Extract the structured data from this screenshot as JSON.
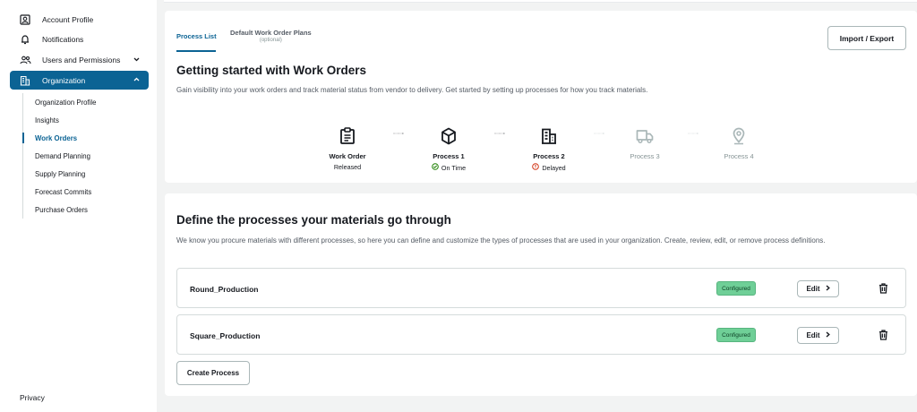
{
  "sidebar": {
    "items": [
      {
        "label": "Account Profile",
        "icon": "account-icon"
      },
      {
        "label": "Notifications",
        "icon": "bell-icon"
      },
      {
        "label": "Users and Permissions",
        "icon": "users-icon"
      },
      {
        "label": "Organization",
        "icon": "building-icon"
      }
    ],
    "sub_items": [
      {
        "label": "Organization Profile"
      },
      {
        "label": "Insights"
      },
      {
        "label": "Work Orders"
      },
      {
        "label": "Demand Planning"
      },
      {
        "label": "Supply Planning"
      },
      {
        "label": "Forecast Commits"
      },
      {
        "label": "Purchase Orders"
      }
    ],
    "privacy": "Privacy"
  },
  "tabs": {
    "process_list": "Process List",
    "default_plans": "Default Work Order Plans",
    "default_plans_note": "(optional)"
  },
  "import_export": "Import / Export",
  "getting_started": {
    "title": "Getting started with Work Orders",
    "description": "Gain visibility into your work orders and track material status from vendor to delivery. Get started by setting up processes for how you track materials.",
    "steps": [
      {
        "name": "Work Order",
        "status": "Released",
        "icon": "clipboard-icon"
      },
      {
        "name": "Process 1",
        "status": "On Time",
        "icon": "box-icon",
        "status_color": "#1d8102"
      },
      {
        "name": "Process 2",
        "status": "Delayed",
        "icon": "factory-icon",
        "status_color": "#d13212"
      },
      {
        "name": "Process 3",
        "status": "",
        "icon": "truck-icon"
      },
      {
        "name": "Process 4",
        "status": "",
        "icon": "location-pin-icon"
      }
    ]
  },
  "define": {
    "title": "Define the processes your materials go through",
    "description": "We know you procure materials with different processes, so here you can define and customize the types of processes that are used in your organization. Create, review, edit, or remove process definitions.",
    "processes": [
      {
        "name": "Round_Production",
        "status": "Configured",
        "edit": "Edit"
      },
      {
        "name": "Square_Production",
        "status": "Configured",
        "edit": "Edit"
      }
    ],
    "create_button": "Create Process"
  },
  "colors": {
    "accent": "#0b6394",
    "badge_green": "#6fcf97",
    "ok_green": "#1d8102",
    "error_red": "#d13212"
  }
}
